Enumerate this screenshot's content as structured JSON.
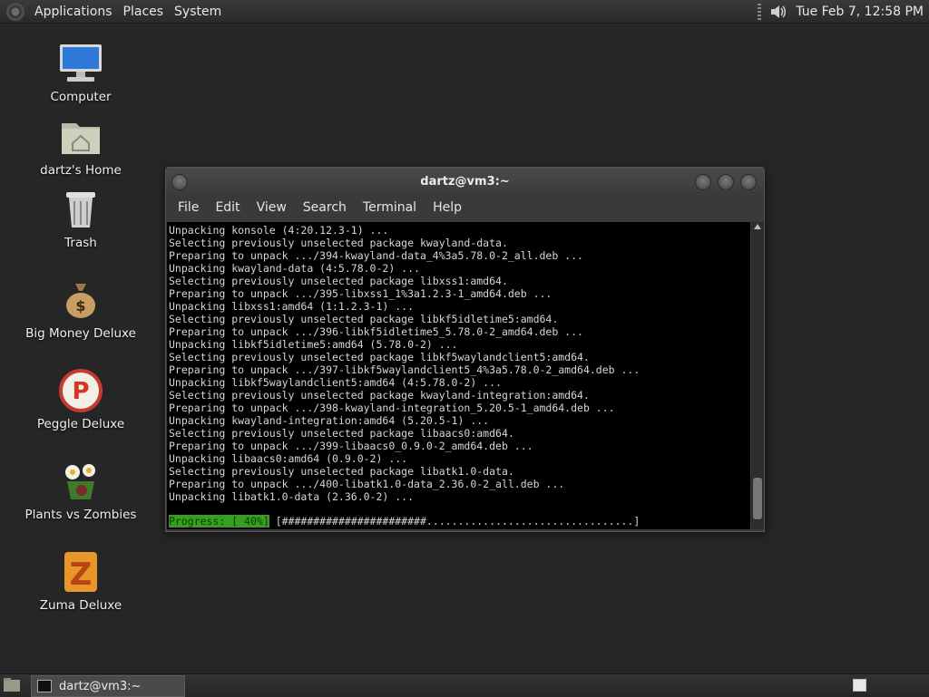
{
  "top_panel": {
    "menus": [
      "Applications",
      "Places",
      "System"
    ],
    "clock": "Tue Feb  7, 12:58 PM"
  },
  "desktop_icons": [
    {
      "label": "Computer",
      "icon": "computer-icon"
    },
    {
      "label": "dartz's Home",
      "icon": "home-folder-icon"
    },
    {
      "label": "Trash",
      "icon": "trash-icon"
    },
    {
      "label": "Big Money Deluxe",
      "icon": "money-bag-icon"
    },
    {
      "label": "Peggle Deluxe",
      "icon": "peggle-icon"
    },
    {
      "label": "Plants vs Zombies",
      "icon": "plants-icon"
    },
    {
      "label": "Zuma Deluxe",
      "icon": "zuma-icon"
    }
  ],
  "window": {
    "title": "dartz@vm3:~",
    "menu": [
      "File",
      "Edit",
      "View",
      "Search",
      "Terminal",
      "Help"
    ],
    "lines": [
      "Unpacking konsole (4:20.12.3-1) ...",
      "Selecting previously unselected package kwayland-data.",
      "Preparing to unpack .../394-kwayland-data_4%3a5.78.0-2_all.deb ...",
      "Unpacking kwayland-data (4:5.78.0-2) ...",
      "Selecting previously unselected package libxss1:amd64.",
      "Preparing to unpack .../395-libxss1_1%3a1.2.3-1_amd64.deb ...",
      "Unpacking libxss1:amd64 (1:1.2.3-1) ...",
      "Selecting previously unselected package libkf5idletime5:amd64.",
      "Preparing to unpack .../396-libkf5idletime5_5.78.0-2_amd64.deb ...",
      "Unpacking libkf5idletime5:amd64 (5.78.0-2) ...",
      "Selecting previously unselected package libkf5waylandclient5:amd64.",
      "Preparing to unpack .../397-libkf5waylandclient5_4%3a5.78.0-2_amd64.deb ...",
      "Unpacking libkf5waylandclient5:amd64 (4:5.78.0-2) ...",
      "Selecting previously unselected package kwayland-integration:amd64.",
      "Preparing to unpack .../398-kwayland-integration_5.20.5-1_amd64.deb ...",
      "Unpacking kwayland-integration:amd64 (5.20.5-1) ...",
      "Selecting previously unselected package libaacs0:amd64.",
      "Preparing to unpack .../399-libaacs0_0.9.0-2_amd64.deb ...",
      "Unpacking libaacs0:amd64 (0.9.0-2) ...",
      "Selecting previously unselected package libatk1.0-data.",
      "Preparing to unpack .../400-libatk1.0-data_2.36.0-2_all.deb ...",
      "Unpacking libatk1.0-data (2.36.0-2) ..."
    ],
    "progress_label": "Progress: [ 40%]",
    "progress_bar": " [#######################.................................]"
  },
  "taskbar": {
    "task_label": "dartz@vm3:~"
  }
}
